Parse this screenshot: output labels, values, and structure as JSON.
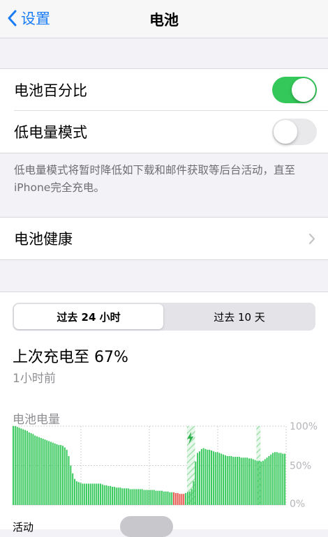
{
  "nav": {
    "back_label": "设置",
    "title": "电池"
  },
  "settings": {
    "battery_percentage": {
      "label": "电池百分比",
      "on": true
    },
    "low_power_mode": {
      "label": "低电量模式",
      "on": false
    },
    "low_power_footnote": "低电量模式将暂时降低如下载和邮件获取等后台活动，直至iPhone完全充电。",
    "battery_health": {
      "label": "电池健康"
    }
  },
  "usage": {
    "segments": [
      "过去 24 小时",
      "过去 10 天"
    ],
    "selected_segment": 0,
    "last_charged": "上次充电至 67%",
    "last_charged_time": "1小时前",
    "next_section_label": "活动"
  },
  "chart_data": {
    "type": "bar",
    "title": "电池电量",
    "ytick_labels": [
      "100%",
      "50%",
      "0%"
    ],
    "ylim": [
      0,
      100
    ],
    "x": "24 hours",
    "values": [
      100,
      100,
      99,
      98,
      97,
      96,
      95,
      94,
      92,
      91,
      90,
      88,
      87,
      86,
      85,
      84,
      83,
      82,
      81,
      80,
      79,
      78,
      77,
      76,
      76,
      75,
      73,
      70,
      62,
      50,
      40,
      33,
      30,
      29,
      28,
      27,
      27,
      27,
      27,
      27,
      27,
      27,
      27,
      27,
      27,
      26,
      25,
      25,
      24,
      24,
      23,
      23,
      22,
      22,
      22,
      21,
      21,
      21,
      21,
      20,
      20,
      20,
      20,
      20,
      20,
      20,
      19,
      19,
      19,
      19,
      19,
      19,
      18,
      18,
      18,
      18,
      17,
      17,
      17,
      16,
      16,
      16,
      15,
      15,
      14,
      14,
      14,
      15,
      16,
      17,
      20,
      30,
      55,
      66,
      68,
      71,
      72,
      71,
      70,
      70,
      69,
      68,
      67,
      67,
      66,
      65,
      64,
      63,
      62,
      62,
      62,
      61,
      61,
      61,
      61,
      60,
      60,
      60,
      60,
      59,
      59,
      58,
      57,
      56,
      56,
      55,
      56,
      58,
      60,
      62,
      64,
      66,
      67,
      67,
      66,
      66,
      65,
      65
    ],
    "status": {
      "low_red": [
        81,
        82,
        83,
        84,
        85,
        86
      ],
      "charging_green_hatched": [
        88,
        89,
        90,
        91
      ],
      "charging_hatched_later": [
        123,
        124
      ]
    }
  },
  "colors": {
    "accent": "#1a7df5",
    "toggle_on": "#34c759",
    "bar_green": "#34c759",
    "bar_red": "#e5534b",
    "charging_hatch": "#a6e4b0"
  }
}
